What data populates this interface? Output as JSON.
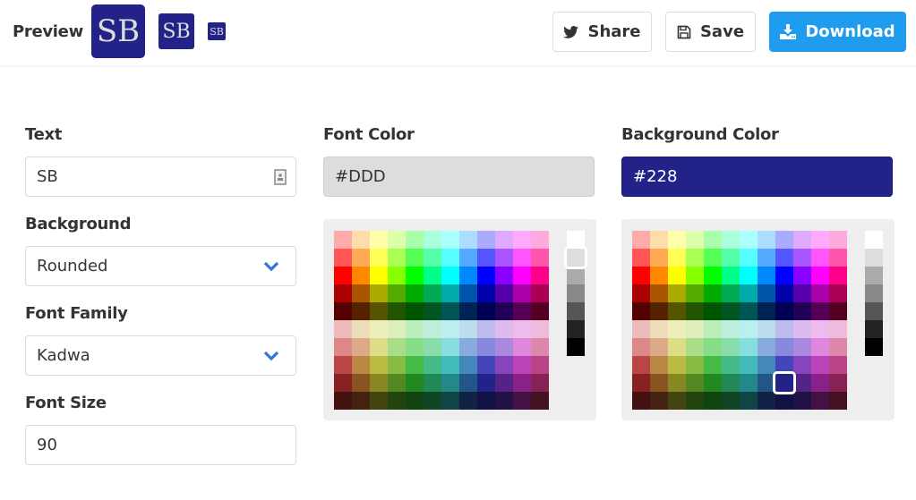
{
  "header": {
    "preview_label": "Preview",
    "preview_text": "SB",
    "buttons": {
      "share": "Share",
      "save": "Save",
      "download": "Download"
    }
  },
  "form": {
    "text": {
      "label": "Text",
      "value": "SB"
    },
    "background": {
      "label": "Background",
      "value": "Rounded"
    },
    "font_family": {
      "label": "Font Family",
      "value": "Kadwa"
    },
    "font_size": {
      "label": "Font Size",
      "value": "90"
    },
    "font_color": {
      "label": "Font Color",
      "value": "#DDD"
    },
    "background_color": {
      "label": "Background Color",
      "value": "#228"
    }
  },
  "colors": {
    "accent": "#209cee",
    "chevron": "#3273dc",
    "selected_font_color": "#DDD",
    "selected_background_color": "#228"
  },
  "palette": {
    "grid": [
      [
        "#FAA",
        "#FDA",
        "#FFA",
        "#DFA",
        "#AFA",
        "#AFD",
        "#AFF",
        "#ADF",
        "#AAF",
        "#DAF",
        "#FAF",
        "#FAD"
      ],
      [
        "#F55",
        "#FA5",
        "#FF5",
        "#AF5",
        "#5F5",
        "#5FA",
        "#5FF",
        "#5AF",
        "#55F",
        "#A5F",
        "#F5F",
        "#F5A"
      ],
      [
        "#F00",
        "#F80",
        "#FF0",
        "#8F0",
        "#0F0",
        "#0F8",
        "#0FF",
        "#08F",
        "#00F",
        "#80F",
        "#F0F",
        "#F08"
      ],
      [
        "#A00",
        "#A50",
        "#AA0",
        "#5A0",
        "#0A0",
        "#0A5",
        "#0AA",
        "#05A",
        "#00A",
        "#50A",
        "#A0A",
        "#A05"
      ],
      [
        "#500",
        "#520",
        "#550",
        "#250",
        "#050",
        "#052",
        "#055",
        "#025",
        "#005",
        "#205",
        "#505",
        "#502"
      ],
      [
        "#EBB",
        "#EDB",
        "#EEB",
        "#DEB",
        "#BEB",
        "#BED",
        "#BEE",
        "#BDE",
        "#BBE",
        "#DBE",
        "#EBE",
        "#EBD"
      ],
      [
        "#D88",
        "#DA8",
        "#DD8",
        "#AD8",
        "#8D8",
        "#8DA",
        "#8DD",
        "#8AD",
        "#88D",
        "#A8D",
        "#D8D",
        "#D8A"
      ],
      [
        "#B44",
        "#B84",
        "#BB4",
        "#8B4",
        "#4B4",
        "#4B8",
        "#4BB",
        "#48B",
        "#44B",
        "#84B",
        "#B4B",
        "#B48"
      ],
      [
        "#822",
        "#852",
        "#882",
        "#582",
        "#282",
        "#285",
        "#288",
        "#258",
        "#228",
        "#528",
        "#828",
        "#825"
      ],
      [
        "#411",
        "#421",
        "#441",
        "#241",
        "#141",
        "#142",
        "#144",
        "#124",
        "#114",
        "#214",
        "#414",
        "#412"
      ]
    ],
    "grayscale": [
      "#FFF",
      "#DDD",
      "#AAA",
      "#888",
      "#555",
      "#222",
      "#000"
    ],
    "font_selected": {
      "column": "grayscale",
      "index": 1
    },
    "background_selected": {
      "row": 8,
      "col": 8
    }
  }
}
